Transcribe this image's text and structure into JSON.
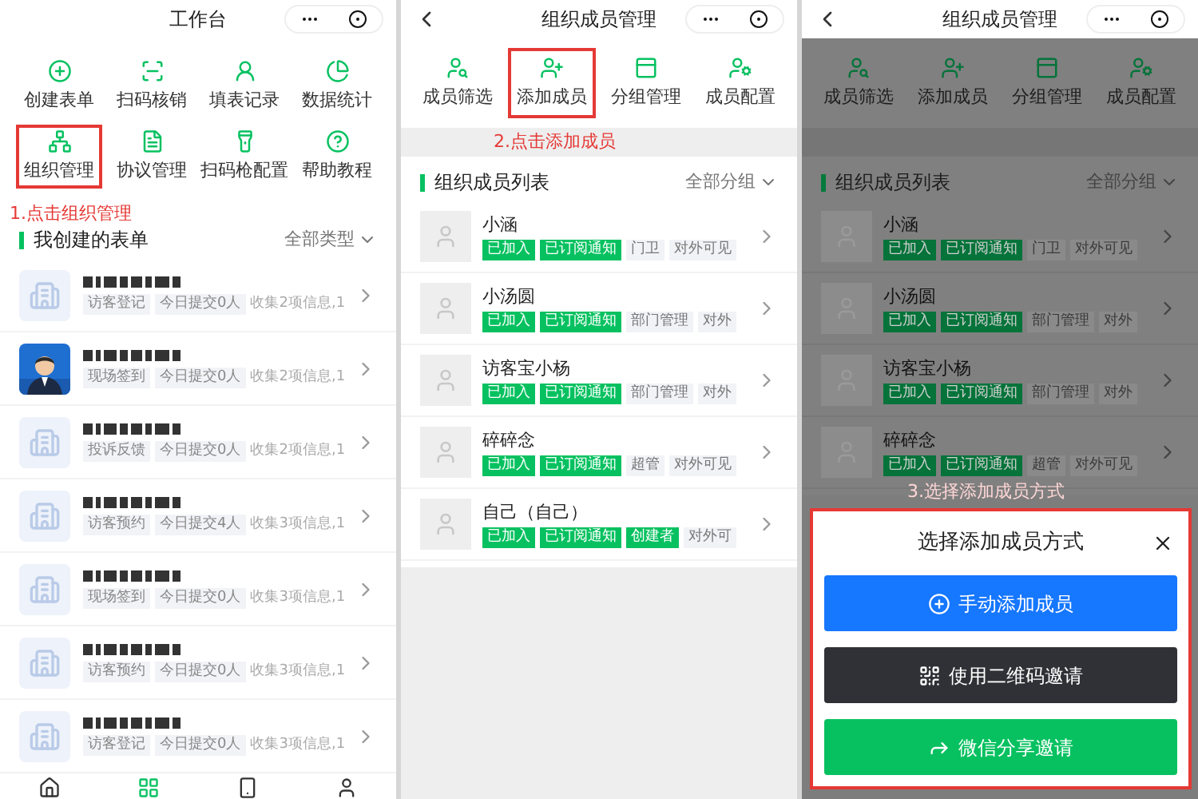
{
  "panels": [
    {
      "kind": "workbench",
      "title": "工作台",
      "shortcuts": [
        {
          "label": "创建表单",
          "highlighted": false
        },
        {
          "label": "扫码核销",
          "highlighted": false
        },
        {
          "label": "填表记录",
          "highlighted": false
        },
        {
          "label": "数据统计",
          "highlighted": false
        },
        {
          "label": "组织管理",
          "highlighted": true
        },
        {
          "label": "协议管理",
          "highlighted": false
        },
        {
          "label": "扫码枪配置",
          "highlighted": false
        },
        {
          "label": "帮助教程",
          "highlighted": false
        }
      ],
      "annotation": "1.点击组织管理",
      "section": {
        "title": "我创建的表单",
        "filter": "全部类型"
      },
      "forms": [
        {
          "kind": "icon",
          "tags": [
            "访客登记",
            "今日提交0人"
          ],
          "info": "收集2项信息,1"
        },
        {
          "kind": "picture",
          "tags": [
            "现场签到",
            "今日提交0人"
          ],
          "info": "收集2项信息,1"
        },
        {
          "kind": "icon",
          "tags": [
            "投诉反馈",
            "今日提交0人"
          ],
          "info": "收集2项信息,1"
        },
        {
          "kind": "icon",
          "tags": [
            "访客预约",
            "今日提交4人"
          ],
          "info": "收集3项信息,1"
        },
        {
          "kind": "icon",
          "tags": [
            "现场签到",
            "今日提交0人"
          ],
          "info": "收集3项信息,1"
        },
        {
          "kind": "icon",
          "tags": [
            "访客预约",
            "今日提交0人"
          ],
          "info": "收集3项信息,1"
        },
        {
          "kind": "icon",
          "tags": [
            "访客登记",
            "今日提交0人"
          ],
          "info": "收集3项信息,1"
        }
      ],
      "tabbar": [
        {
          "selected": false
        },
        {
          "selected": true
        },
        {
          "selected": false
        },
        {
          "selected": false
        }
      ]
    },
    {
      "kind": "members",
      "title": "组织成员管理",
      "dimmed": false,
      "actions": [
        {
          "label": "成员筛选",
          "highlighted": false
        },
        {
          "label": "添加成员",
          "highlighted": true
        },
        {
          "label": "分组管理",
          "highlighted": false
        },
        {
          "label": "成员配置",
          "highlighted": false
        }
      ],
      "annotation": "2.点击添加成员",
      "section": {
        "title": "组织成员列表",
        "filter": "全部分组"
      },
      "members": [
        {
          "name": "小涵",
          "tags": [
            {
              "label": "已加入",
              "kind": "badge"
            },
            {
              "label": "已订阅通知",
              "kind": "badge"
            },
            {
              "label": "门卫",
              "kind": "label"
            },
            {
              "label": "对外可见",
              "kind": "label"
            }
          ]
        },
        {
          "name": "小汤圆",
          "tags": [
            {
              "label": "已加入",
              "kind": "badge"
            },
            {
              "label": "已订阅通知",
              "kind": "badge"
            },
            {
              "label": "部门管理",
              "kind": "label"
            },
            {
              "label": "对外",
              "kind": "label"
            }
          ]
        },
        {
          "name": "访客宝小杨",
          "tags": [
            {
              "label": "已加入",
              "kind": "badge"
            },
            {
              "label": "已订阅通知",
              "kind": "badge"
            },
            {
              "label": "部门管理",
              "kind": "label"
            },
            {
              "label": "对外",
              "kind": "label"
            }
          ]
        },
        {
          "name": "碎碎念",
          "tags": [
            {
              "label": "已加入",
              "kind": "badge"
            },
            {
              "label": "已订阅通知",
              "kind": "badge"
            },
            {
              "label": "超管",
              "kind": "label"
            },
            {
              "label": "对外可见",
              "kind": "label"
            }
          ]
        },
        {
          "name": "自己（自己）",
          "tags": [
            {
              "label": "已加入",
              "kind": "badge"
            },
            {
              "label": "已订阅通知",
              "kind": "badge"
            },
            {
              "label": "创建者",
              "kind": "badge"
            },
            {
              "label": "对外可",
              "kind": "label"
            }
          ]
        }
      ]
    },
    {
      "kind": "members",
      "title": "组织成员管理",
      "dimmed": true,
      "actions": [
        {
          "label": "成员筛选",
          "highlighted": false
        },
        {
          "label": "添加成员",
          "highlighted": false
        },
        {
          "label": "分组管理",
          "highlighted": false
        },
        {
          "label": "成员配置",
          "highlighted": false
        }
      ],
      "section": {
        "title": "组织成员列表",
        "filter": "全部分组"
      },
      "members": [
        {
          "name": "小涵",
          "tags": [
            {
              "label": "已加入",
              "kind": "badge"
            },
            {
              "label": "已订阅通知",
              "kind": "badge"
            },
            {
              "label": "门卫",
              "kind": "label"
            },
            {
              "label": "对外可见",
              "kind": "label"
            }
          ]
        },
        {
          "name": "小汤圆",
          "tags": [
            {
              "label": "已加入",
              "kind": "badge"
            },
            {
              "label": "已订阅通知",
              "kind": "badge"
            },
            {
              "label": "部门管理",
              "kind": "label"
            },
            {
              "label": "对外",
              "kind": "label"
            }
          ]
        },
        {
          "name": "访客宝小杨",
          "tags": [
            {
              "label": "已加入",
              "kind": "badge"
            },
            {
              "label": "已订阅通知",
              "kind": "badge"
            },
            {
              "label": "部门管理",
              "kind": "label"
            },
            {
              "label": "对外",
              "kind": "label"
            }
          ]
        },
        {
          "name": "碎碎念",
          "tags": [
            {
              "label": "已加入",
              "kind": "badge"
            },
            {
              "label": "已订阅通知",
              "kind": "badge"
            },
            {
              "label": "超管",
              "kind": "label"
            },
            {
              "label": "对外可见",
              "kind": "label"
            }
          ]
        }
      ],
      "sheet": {
        "annotation": "3.选择添加成员方式",
        "title": "选择添加成员方式",
        "buttons": [
          {
            "label": "手动添加成员",
            "color": "#1677ff"
          },
          {
            "label": "使用二维码邀请",
            "color": "#2f3136"
          },
          {
            "label": "微信分享邀请",
            "color": "#07c160"
          }
        ]
      }
    }
  ]
}
